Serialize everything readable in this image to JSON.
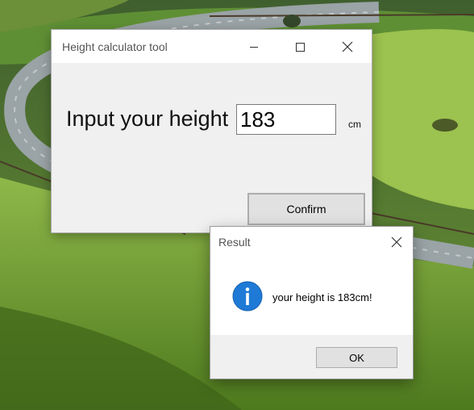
{
  "desktop": {
    "wallpaper": "grassy-hills-winding-road"
  },
  "main_window": {
    "title": "Height calculator tool",
    "input_label": "Input your height",
    "height_value": "183",
    "unit": "cm",
    "confirm_label": "Confirm",
    "icons": {
      "minimize": "minimize-icon",
      "maximize": "maximize-icon",
      "close": "close-icon"
    }
  },
  "result_dialog": {
    "title": "Result",
    "message": "your height is 183cm!",
    "ok_label": "OK",
    "icons": {
      "info": "info-icon",
      "close": "close-icon"
    },
    "colors": {
      "info_blue": "#1e7ad6"
    }
  }
}
